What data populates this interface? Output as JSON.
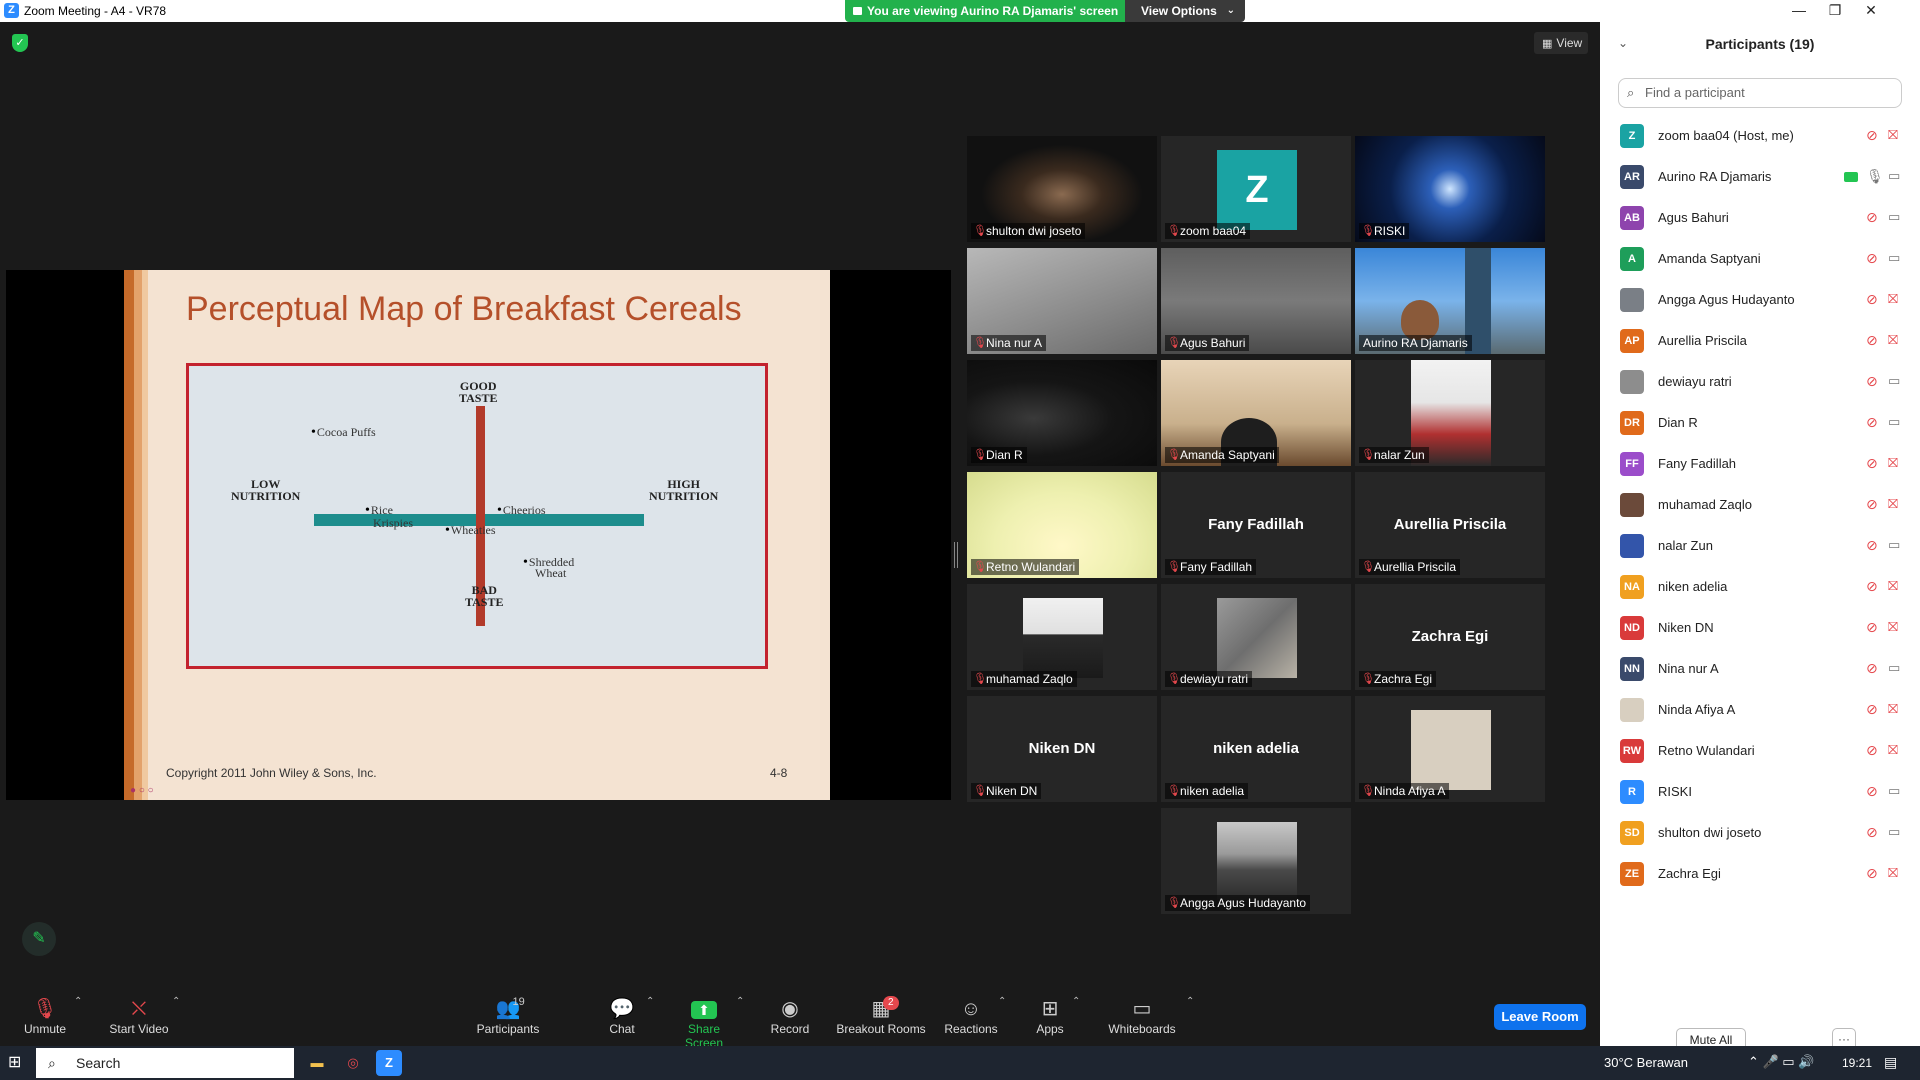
{
  "window": {
    "title": "Zoom Meeting - A4 - VR78",
    "app_icon": "Z",
    "share_banner": "You are viewing Aurino RA Djamaris' screen",
    "view_options": "View Options",
    "minimize": "—",
    "maximize": "❐",
    "close": "✕"
  },
  "main": {
    "view_button": "View"
  },
  "slide": {
    "title": "Perceptual Map of Breakfast Cereals",
    "axis_top": [
      "GOOD",
      "TASTE"
    ],
    "axis_bottom": [
      "BAD",
      "TASTE"
    ],
    "axis_left": [
      "LOW",
      "NUTRITION"
    ],
    "axis_right": [
      "HIGH",
      "NUTRITION"
    ],
    "brands": [
      "Cocoa Puffs",
      "Rice",
      "Krispies",
      "Cheerios",
      "Wheaties",
      "Shredded",
      "Wheat"
    ],
    "footer": "Copyright 2011 John Wiley & Sons, Inc.",
    "page_number": "4-8"
  },
  "tiles": [
    {
      "name": "shulton dwi joseto"
    },
    {
      "name": "zoom baa04",
      "initial": "Z"
    },
    {
      "name": "RISKI"
    },
    {
      "name": "Nina nur A"
    },
    {
      "name": "Agus Bahuri"
    },
    {
      "name": "Aurino RA Djamaris"
    },
    {
      "name": "Dian R"
    },
    {
      "name": "Amanda Saptyani"
    },
    {
      "name": "nalar Zun"
    },
    {
      "name": "Retno Wulandari"
    },
    {
      "name": "Fany Fadillah",
      "display": "Fany Fadillah"
    },
    {
      "name": "Aurellia Priscila",
      "display": "Aurellia Priscila"
    },
    {
      "name": "muhamad Zaqlo"
    },
    {
      "name": "dewiayu ratri"
    },
    {
      "name": "Zachra Egi",
      "display": "Zachra Egi"
    },
    {
      "name": "Niken DN",
      "display": "Niken DN"
    },
    {
      "name": "niken adelia",
      "display": "niken adelia"
    },
    {
      "name": "Ninda Afiya A"
    },
    {
      "name": "Angga Agus Hudayanto"
    }
  ],
  "toolbar": {
    "unmute": "Unmute",
    "start_video": "Start Video",
    "participants": "Participants",
    "participants_count": "19",
    "chat": "Chat",
    "share_screen": "Share Screen",
    "record": "Record",
    "breakout_rooms": "Breakout Rooms",
    "breakout_badge": "2",
    "reactions": "Reactions",
    "apps": "Apps",
    "whiteboards": "Whiteboards",
    "leave_room": "Leave Room"
  },
  "panel": {
    "title": "Participants (19)",
    "search_placeholder": "Find a participant",
    "mute_all": "Mute All",
    "more": "···",
    "participants": [
      {
        "initials": "Z",
        "name": "zoom baa04 (Host, me)",
        "color": "#1aa3a3",
        "video_on": false,
        "mic_on": false
      },
      {
        "initials": "AR",
        "name": "Aurino RA Djamaris",
        "color": "#3a4a6b",
        "video_on": true,
        "mic_on": true,
        "sharing": true
      },
      {
        "initials": "AB",
        "name": "Agus Bahuri",
        "color": "#8e44ad",
        "video_on": true,
        "mic_on": false
      },
      {
        "initials": "A",
        "name": "Amanda Saptyani",
        "color": "#1e9e5a",
        "video_on": true,
        "mic_on": false
      },
      {
        "initials": "",
        "name": "Angga Agus Hudayanto",
        "color": "#7a7f86",
        "video_on": false,
        "mic_on": false
      },
      {
        "initials": "AP",
        "name": "Aurellia Priscila",
        "color": "#e06a1b",
        "video_on": false,
        "mic_on": false
      },
      {
        "initials": "",
        "name": "dewiayu ratri",
        "color": "#8d8d8d",
        "video_on": true,
        "mic_on": false
      },
      {
        "initials": "DR",
        "name": "Dian R",
        "color": "#e06a1b",
        "video_on": true,
        "mic_on": false
      },
      {
        "initials": "FF",
        "name": "Fany Fadillah",
        "color": "#9b4dca",
        "video_on": false,
        "mic_on": false
      },
      {
        "initials": "",
        "name": "muhamad Zaqlo",
        "color": "#6b4a3a",
        "video_on": false,
        "mic_on": false
      },
      {
        "initials": "",
        "name": "nalar Zun",
        "color": "#3355aa",
        "video_on": true,
        "mic_on": false
      },
      {
        "initials": "NA",
        "name": "niken adelia",
        "color": "#f0a020",
        "video_on": false,
        "mic_on": false
      },
      {
        "initials": "ND",
        "name": "Niken DN",
        "color": "#d93a3a",
        "video_on": false,
        "mic_on": false
      },
      {
        "initials": "NN",
        "name": "Nina nur A",
        "color": "#3a4a6b",
        "video_on": true,
        "mic_on": false
      },
      {
        "initials": "",
        "name": "Ninda Afiya A",
        "color": "#d8cfc0",
        "video_on": false,
        "mic_on": false
      },
      {
        "initials": "RW",
        "name": "Retno Wulandari",
        "color": "#d93a3a",
        "video_on": false,
        "mic_on": false
      },
      {
        "initials": "R",
        "name": "RISKI",
        "color": "#2d8cff",
        "video_on": true,
        "mic_on": false
      },
      {
        "initials": "SD",
        "name": "shulton dwi joseto",
        "color": "#f0a020",
        "video_on": true,
        "mic_on": false
      },
      {
        "initials": "ZE",
        "name": "Zachra Egi",
        "color": "#e06a1b",
        "video_on": false,
        "mic_on": false
      }
    ]
  },
  "taskbar": {
    "search": "Search",
    "weather": "30°C  Berawan",
    "clock": "19:21"
  },
  "colors": {
    "accent_blue": "#0e72ed",
    "share_green": "#23c552",
    "muted_red": "#e5484d",
    "active_speaker": "#f2e97a"
  }
}
